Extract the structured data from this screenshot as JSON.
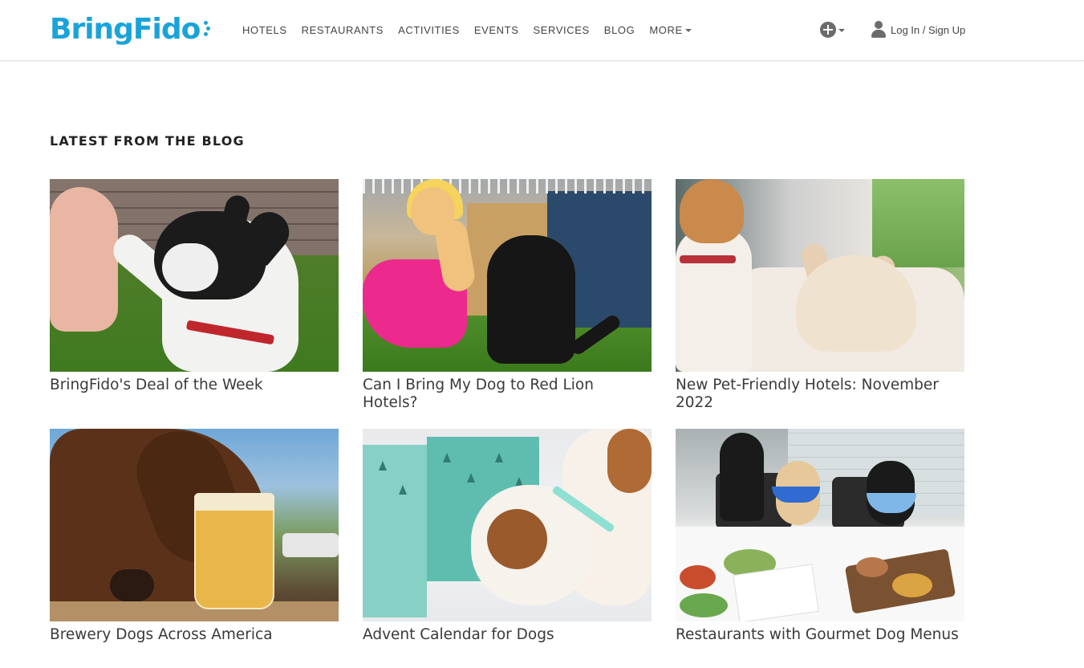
{
  "header": {
    "logo_text": "BringFido",
    "nav": [
      {
        "label": "HOTELS"
      },
      {
        "label": "RESTAURANTS"
      },
      {
        "label": "ACTIVITIES"
      },
      {
        "label": "EVENTS"
      },
      {
        "label": "SERVICES"
      },
      {
        "label": "BLOG"
      },
      {
        "label": "MORE"
      }
    ],
    "add_icon": "plus-circle-icon",
    "user_icon": "user-icon",
    "login_label": "Log In / Sign Up"
  },
  "blog": {
    "title": "LATEST FROM THE BLOG",
    "posts": [
      {
        "title": "BringFido's Deal of the Week",
        "image": "boston-terrier-high-five"
      },
      {
        "title": "Can I Bring My Dog to Red Lion Hotels?",
        "image": "woman-with-black-dog"
      },
      {
        "title": "New Pet-Friendly Hotels: November 2022",
        "image": "jack-russell-and-french-bulldog"
      },
      {
        "title": "Brewery Dogs Across America",
        "image": "chocolate-lab-with-beer"
      },
      {
        "title": "Advent Calendar for Dogs",
        "image": "dog-with-advent-calendar"
      },
      {
        "title": "Restaurants with Gourmet Dog Menus",
        "image": "dogs-at-restaurant-table"
      }
    ]
  },
  "colors": {
    "brand": "#1aa3d9",
    "nav_text": "#444444",
    "heading": "#222222",
    "post_title": "#3a3a3a"
  }
}
